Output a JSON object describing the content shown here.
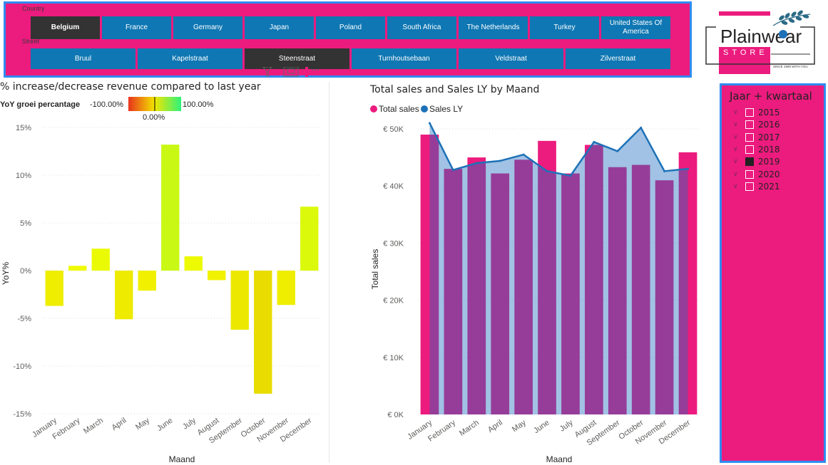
{
  "filters": {
    "country_label": "Country",
    "countries": [
      {
        "label": "Belgium",
        "selected": true
      },
      {
        "label": "France",
        "selected": false
      },
      {
        "label": "Germany",
        "selected": false
      },
      {
        "label": "Japan",
        "selected": false
      },
      {
        "label": "Poland",
        "selected": false
      },
      {
        "label": "South Africa",
        "selected": false
      },
      {
        "label": "The Netherlands",
        "selected": false
      },
      {
        "label": "Turkey",
        "selected": false
      },
      {
        "label": "United States Of America",
        "selected": false
      }
    ],
    "street_label": "Street",
    "streets": [
      {
        "label": "Bruul",
        "selected": false
      },
      {
        "label": "Kapelstraat",
        "selected": false
      },
      {
        "label": "Steenstraat",
        "selected": true
      },
      {
        "label": "Turnhoutsebaan",
        "selected": false
      },
      {
        "label": "Veldstraat",
        "selected": false
      },
      {
        "label": "Zilverstraat",
        "selected": false
      }
    ]
  },
  "logo": {
    "main": "Plainwear",
    "sub": "STORE",
    "tagline": "SINCE 1990 WITH YOU"
  },
  "year_slicer": {
    "title": "Jaar + kwartaal",
    "years": [
      {
        "label": "2015",
        "checked": false
      },
      {
        "label": "2016",
        "checked": false
      },
      {
        "label": "2017",
        "checked": false
      },
      {
        "label": "2018",
        "checked": false
      },
      {
        "label": "2019",
        "checked": true
      },
      {
        "label": "2020",
        "checked": false
      },
      {
        "label": "2021",
        "checked": false
      }
    ]
  },
  "colors": {
    "brand_pink": "#ec1b7e",
    "button_blue": "#0f77b3",
    "selected_dark": "#333333",
    "frame_blue": "#2f8bf0",
    "bar_purple": "#8e3f93",
    "area_blue": "#9ec8e3",
    "line_blue": "#1d71b8"
  },
  "chart_data": [
    {
      "type": "bar",
      "title": "% increase/decrease revenue compared to last year",
      "legend_title": "YoY groei percantage",
      "legend_min": "-100.00%",
      "legend_max": "100.00%",
      "legend_mid": "0.00%",
      "xlabel": "Maand",
      "ylabel": "YoY%",
      "categories": [
        "January",
        "February",
        "March",
        "April",
        "May",
        "June",
        "July",
        "August",
        "September",
        "October",
        "November",
        "December"
      ],
      "values": [
        -3.7,
        0.5,
        2.3,
        -5.1,
        -2.1,
        13.2,
        1.5,
        -1.0,
        -6.2,
        -12.9,
        -3.6,
        6.7
      ],
      "ylim": [
        -15,
        15
      ],
      "yticks": [
        15,
        10,
        5,
        0,
        -5,
        -10,
        -15
      ],
      "ytick_labels": [
        "15%",
        "10%",
        "5%",
        "0%",
        "-5%",
        "-10%",
        "-15%"
      ],
      "grid": true
    },
    {
      "type": "bar",
      "title": "Total sales and Sales LY by Maand",
      "xlabel": "Maand",
      "ylabel": "Total sales",
      "legend": [
        "Total sales",
        "Sales LY"
      ],
      "legend_position": "top-left",
      "categories": [
        "January",
        "February",
        "March",
        "April",
        "May",
        "June",
        "July",
        "August",
        "September",
        "October",
        "November",
        "December"
      ],
      "series": [
        {
          "name": "Total sales",
          "values": [
            49000,
            43000,
            45000,
            42200,
            44600,
            47900,
            42200,
            47200,
            43300,
            43700,
            41000,
            45900
          ]
        },
        {
          "name": "Sales LY",
          "values": [
            51000,
            42800,
            44000,
            44400,
            45500,
            42600,
            41800,
            47700,
            46100,
            50200,
            42600,
            43000
          ]
        }
      ],
      "ylim": [
        0,
        50000
      ],
      "yticks": [
        50000,
        40000,
        30000,
        20000,
        10000,
        0
      ],
      "ytick_labels": [
        "€ 50K",
        "€ 40K",
        "€ 30K",
        "€ 20K",
        "€ 10K",
        "€ 0K"
      ],
      "grid": true
    }
  ]
}
